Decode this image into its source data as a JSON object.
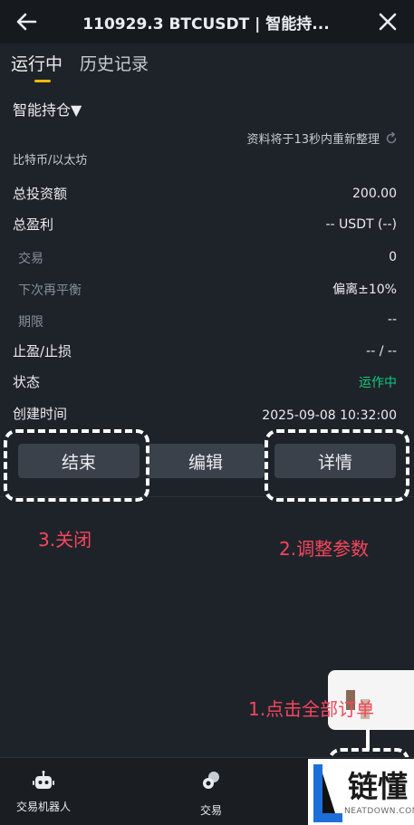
{
  "header": {
    "title": "110929.3 BTCUSDT | 智能持...",
    "back_icon": "arrow-left-icon",
    "close_icon": "close-icon"
  },
  "tabs": [
    {
      "label": "运行中",
      "active": true
    },
    {
      "label": "历史记录",
      "active": false
    }
  ],
  "strategy": {
    "type_label": "智能持仓▼",
    "refresh_text": "资料将于13秒内重新整理",
    "pair_label": "比特币/以太坊"
  },
  "details": {
    "total_investment": {
      "label": "总投资额",
      "value": "200.00"
    },
    "total_profit": {
      "label": "总盈利",
      "value": "-- USDT (--)"
    },
    "trades": {
      "label": "交易",
      "value": "0"
    },
    "next_rebalance": {
      "label": "下次再平衡",
      "value": "偏离±10%"
    },
    "term": {
      "label": "期限",
      "value": "--"
    },
    "tp_sl": {
      "label": "止盈/止损",
      "value": "-- / --"
    },
    "status": {
      "label": "状态",
      "value": "运作中"
    },
    "created_time": {
      "label": "创建时间",
      "value": "2025-09-08 10:32:00"
    }
  },
  "actions": {
    "end_label": "结束",
    "edit_label": "编辑",
    "details_label": "详情"
  },
  "annotations": {
    "close": "3.关闭",
    "adjust": "2.调整参数",
    "all_orders": "1.点击全部订单"
  },
  "bottom_nav": [
    {
      "label": "交易机器人",
      "icon": "robot-icon"
    },
    {
      "label": "交易",
      "icon": "trade-icon"
    }
  ],
  "watermark": {
    "text_cn": "链懂",
    "text_en": "NEATDOWN.COM"
  },
  "colors": {
    "background": "#1e2329",
    "accent": "#f0b90b",
    "positive": "#0ecb81",
    "annotation": "#f6465d"
  }
}
